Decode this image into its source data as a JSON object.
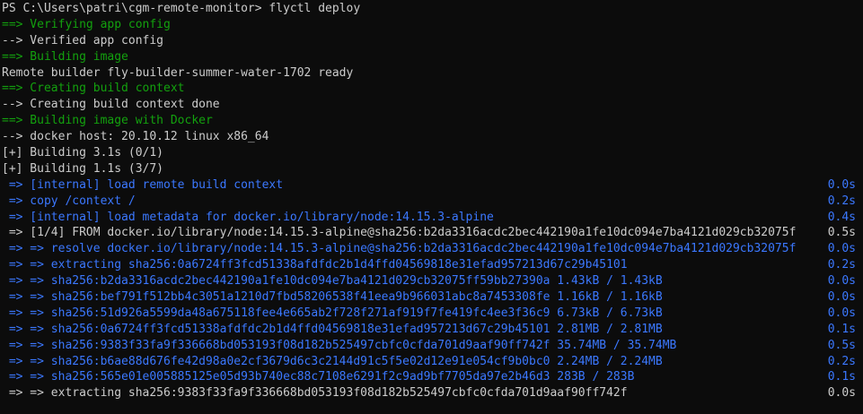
{
  "window": {
    "prompt": "PS C:\\Users\\patri\\cgm-remote-monitor>",
    "command": "flyctl deploy"
  },
  "colors": {
    "background": "#0c0c0c",
    "text": "#cccccc",
    "step": "#13a10e",
    "buildkit": "#3b78ff"
  },
  "lines": [
    {
      "text": "==> Verifying app config",
      "color": "green"
    },
    {
      "text": "--> Verified app config",
      "color": "white"
    },
    {
      "text": "==> Building image",
      "color": "green"
    },
    {
      "text": "Remote builder fly-builder-summer-water-1702 ready",
      "color": "white"
    },
    {
      "text": "==> Creating build context",
      "color": "green"
    },
    {
      "text": "--> Creating build context done",
      "color": "white"
    },
    {
      "text": "==> Building image with Docker",
      "color": "green"
    },
    {
      "text": "--> docker host: 20.10.12 linux x86_64",
      "color": "white"
    },
    {
      "text": "[+] Building 3.1s (0/1)",
      "color": "white"
    },
    {
      "text": "[+] Building 1.1s (3/7)",
      "color": "white"
    },
    {
      "text": " => [internal] load remote build context",
      "time": "0.0s",
      "color": "blue"
    },
    {
      "text": " => copy /context /",
      "time": "0.2s",
      "color": "blue"
    },
    {
      "text": " => [internal] load metadata for docker.io/library/node:14.15.3-alpine",
      "time": "0.4s",
      "color": "blue"
    },
    {
      "text": " => [1/4] FROM docker.io/library/node:14.15.3-alpine@sha256:b2da3316acdc2bec442190a1fe10dc094e7ba4121d029cb32075f",
      "time": "0.5s",
      "color": "white"
    },
    {
      "text": " => => resolve docker.io/library/node:14.15.3-alpine@sha256:b2da3316acdc2bec442190a1fe10dc094e7ba4121d029cb32075f",
      "time": "0.0s",
      "color": "blue"
    },
    {
      "text": " => => extracting sha256:0a6724ff3fcd51338afdfdc2b1d4ffd04569818e31efad957213d67c29b45101",
      "time": "0.2s",
      "color": "blue"
    },
    {
      "text": " => => sha256:b2da3316acdc2bec442190a1fe10dc094e7ba4121d029cb32075ff59bb27390a 1.43kB / 1.43kB",
      "time": "0.0s",
      "color": "blue"
    },
    {
      "text": " => => sha256:bef791f512bb4c3051a1210d7fbd58206538f41eea9b966031abc8a7453308fe 1.16kB / 1.16kB",
      "time": "0.0s",
      "color": "blue"
    },
    {
      "text": " => => sha256:51d926a5599da48a675118fee4e665ab2f728f271af919f7fe419fc4ee3f36c9 6.73kB / 6.73kB",
      "time": "0.0s",
      "color": "blue"
    },
    {
      "text": " => => sha256:0a6724ff3fcd51338afdfdc2b1d4ffd04569818e31efad957213d67c29b45101 2.81MB / 2.81MB",
      "time": "0.1s",
      "color": "blue"
    },
    {
      "text": " => => sha256:9383f33fa9f336668bd053193f08d182b525497cbfc0cfda701d9aaf90ff742f 35.74MB / 35.74MB",
      "time": "0.5s",
      "color": "blue"
    },
    {
      "text": " => => sha256:b6ae88d676fe42d98a0e2cf3679d6c3c2144d91c5f5e02d12e91e054cf9b0bc0 2.24MB / 2.24MB",
      "time": "0.2s",
      "color": "blue"
    },
    {
      "text": " => => sha256:565e01e005885125e05d93b740ec88c7108e6291f2c9ad9bf7705da97e2b46d3 283B / 283B",
      "time": "0.1s",
      "color": "blue"
    },
    {
      "text": " => => extracting sha256:9383f33fa9f336668bd053193f08d182b525497cbfc0cfda701d9aaf90ff742f",
      "time": "0.0s",
      "color": "white"
    }
  ]
}
